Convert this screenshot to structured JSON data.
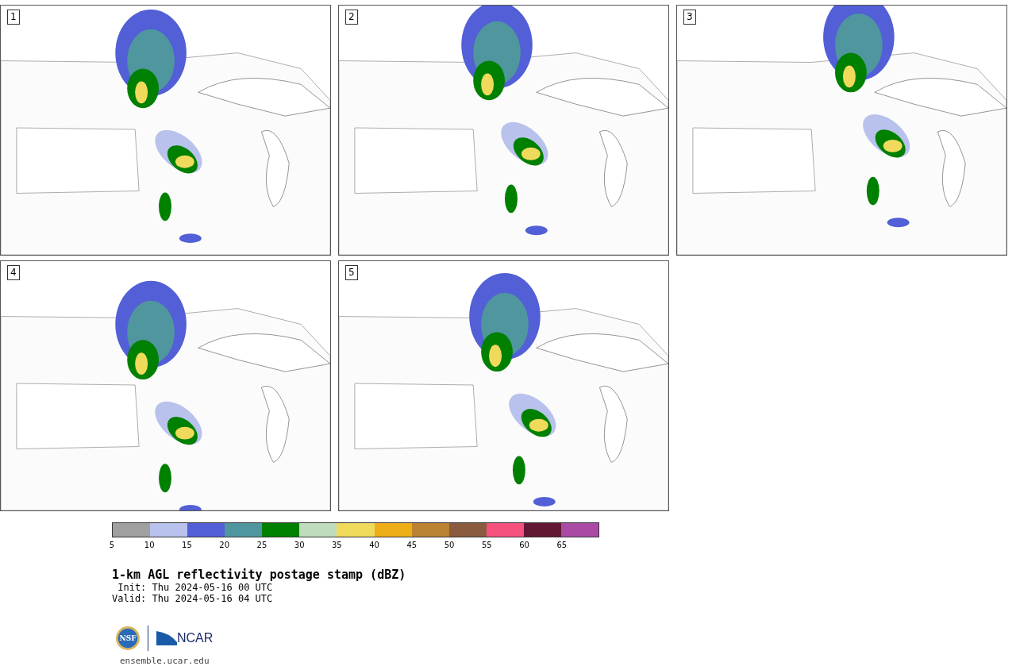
{
  "panels": [
    {
      "label": "1"
    },
    {
      "label": "2"
    },
    {
      "label": "3"
    },
    {
      "label": "4"
    },
    {
      "label": "5"
    }
  ],
  "colorbar": {
    "segments": [
      {
        "color": "#a0a0a0"
      },
      {
        "color": "#b8c2ec"
      },
      {
        "color": "#525fd6"
      },
      {
        "color": "#50969e"
      },
      {
        "color": "#008000"
      },
      {
        "color": "#bfdcbc"
      },
      {
        "color": "#f0da5c"
      },
      {
        "color": "#eeae18"
      },
      {
        "color": "#bb8231"
      },
      {
        "color": "#8a5b3e"
      },
      {
        "color": "#f4517e"
      },
      {
        "color": "#621834"
      },
      {
        "color": "#ab4aa4"
      }
    ],
    "ticks": [
      "5",
      "10",
      "15",
      "20",
      "25",
      "30",
      "35",
      "40",
      "45",
      "50",
      "55",
      "60",
      "65"
    ]
  },
  "title": "1-km AGL reflectivity postage stamp (dBZ)",
  "init": " Init: Thu 2024-05-16 00 UTC",
  "valid": "Valid: Thu 2024-05-16 04 UTC",
  "logo": {
    "left": "NSF",
    "right": "NCAR"
  },
  "site": "ensemble.ucar.edu"
}
